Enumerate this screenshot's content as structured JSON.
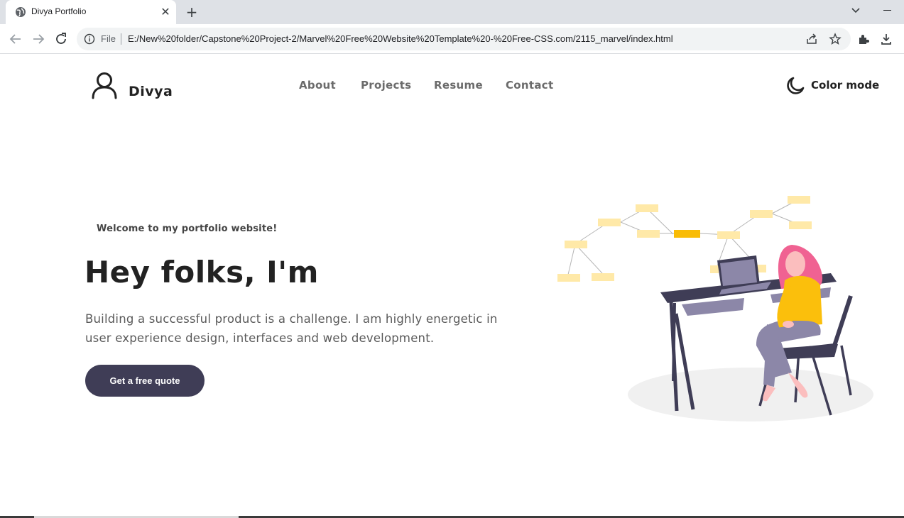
{
  "browser": {
    "tab_title": "Divya Portfolio",
    "url_scheme_label": "File",
    "url": "E:/New%20folder/Capstone%20Project-2/Marvel%20Free%20Website%20Template%20-%20Free-CSS.com/2115_marvel/index.html"
  },
  "header": {
    "brand_name": "Divya",
    "nav": [
      "About",
      "Projects",
      "Resume",
      "Contact"
    ],
    "color_mode_label": "Color mode"
  },
  "hero": {
    "welcome": "Welcome to my portfolio website!",
    "headline": "Hey folks, I'm",
    "intro": "Building a successful product is a challenge. I am highly energetic in user experience design, interfaces and web development.",
    "cta_label": "Get a free quote"
  },
  "colors": {
    "accent_dark": "#3f3d56",
    "note_yellow": "#ffe9a8",
    "note_highlight": "#f9bc06",
    "hair_pink": "#f06292",
    "shirt_yellow": "#fbbf0c",
    "chrome_bg": "#dee1e6"
  }
}
